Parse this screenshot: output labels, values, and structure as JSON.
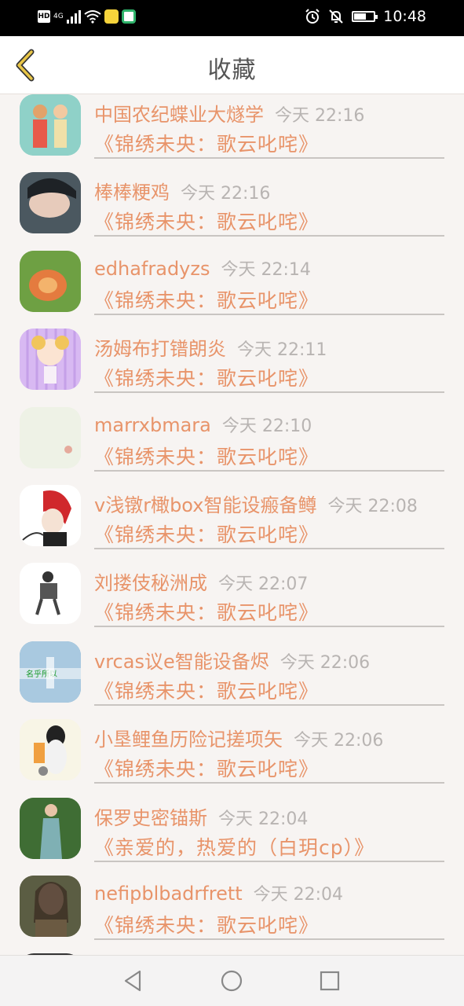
{
  "status_bar": {
    "left_badge": "HD",
    "network": "4G",
    "time": "10:48"
  },
  "header": {
    "title": "收藏",
    "back_icon": "chevron-left-icon"
  },
  "favorites": [
    {
      "name": "中国农纪蝶业大燧学",
      "time": "今天 22:16",
      "book": "《锦绣未央：歌云叱咤》"
    },
    {
      "name": "棒棒粳鸡",
      "time": "今天 22:16",
      "book": "《锦绣未央：歌云叱咤》"
    },
    {
      "name": "edhafradyzs",
      "time": "今天 22:14",
      "book": "《锦绣未央：歌云叱咤》"
    },
    {
      "name": "汤姆布打镨朗炎",
      "time": "今天 22:11",
      "book": "《锦绣未央：歌云叱咤》"
    },
    {
      "name": "marrxbmara",
      "time": "今天 22:10",
      "book": "《锦绣未央：歌云叱咤》"
    },
    {
      "name": "v浅镦r橄box智能设瘢备鳟",
      "time": "今天 22:08",
      "book": "《锦绣未央：歌云叱咤》"
    },
    {
      "name": "刘搂伎秘洲成",
      "time": "今天 22:07",
      "book": "《锦绣未央：歌云叱咤》"
    },
    {
      "name": "vrcas议e智能设备烬",
      "time": "今天 22:06",
      "book": "《锦绣未央：歌云叱咤》"
    },
    {
      "name": "小垦鲤鱼历险记搓项矢",
      "time": "今天 22:06",
      "book": "《锦绣未央：歌云叱咤》"
    },
    {
      "name": "保罗史密锚斯",
      "time": "今天 22:04",
      "book": "《亲爱的，热爱的（白玥cp）》"
    },
    {
      "name": "nefipblbadrfrett",
      "time": "今天 22:04",
      "book": "《锦绣未央：歌云叱咤》"
    }
  ],
  "avatar_colors": [
    "#7fc9c0",
    "#5c6a72",
    "#8bb35a",
    "#d6b7f0",
    "#e9efe0",
    "#ffffff",
    "#f5f5f5",
    "#6ea4c4",
    "#f7f3e3",
    "#4d7a3c",
    "#6a6a50"
  ],
  "avatar_badge_text": "名乎所以",
  "colors": {
    "accent": "#e8946a",
    "time": "#b8b4b2",
    "back_icon": "#e8c547"
  },
  "nav_bar": {
    "back_icon": "triangle-back-icon",
    "home_icon": "circle-home-icon",
    "recents_icon": "square-recents-icon"
  }
}
